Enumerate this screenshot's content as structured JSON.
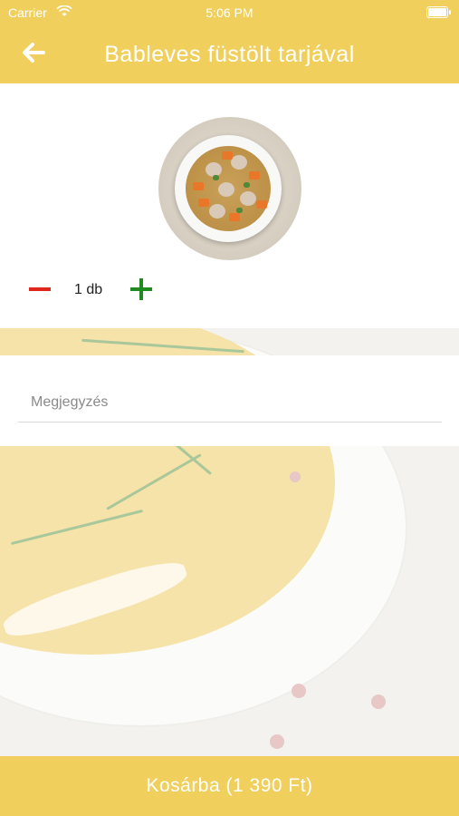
{
  "status_bar": {
    "carrier": "Carrier",
    "time": "5:06 PM",
    "wifi_icon": "wifi-icon",
    "battery_icon": "battery-icon"
  },
  "nav": {
    "back_icon": "arrow-left-icon",
    "title": "Bableves füstölt tarjával"
  },
  "product": {
    "image_desc": "soup-bowl-image",
    "quantity_label": "1 db",
    "minus_icon": "minus-icon",
    "plus_icon": "plus-icon"
  },
  "note": {
    "placeholder": "Megjegyzés",
    "value": ""
  },
  "cart": {
    "button_label": "Kosárba (1 390 Ft)"
  },
  "colors": {
    "accent": "#f0cf5c",
    "minus": "#e0251c",
    "plus": "#1f8a1f"
  }
}
